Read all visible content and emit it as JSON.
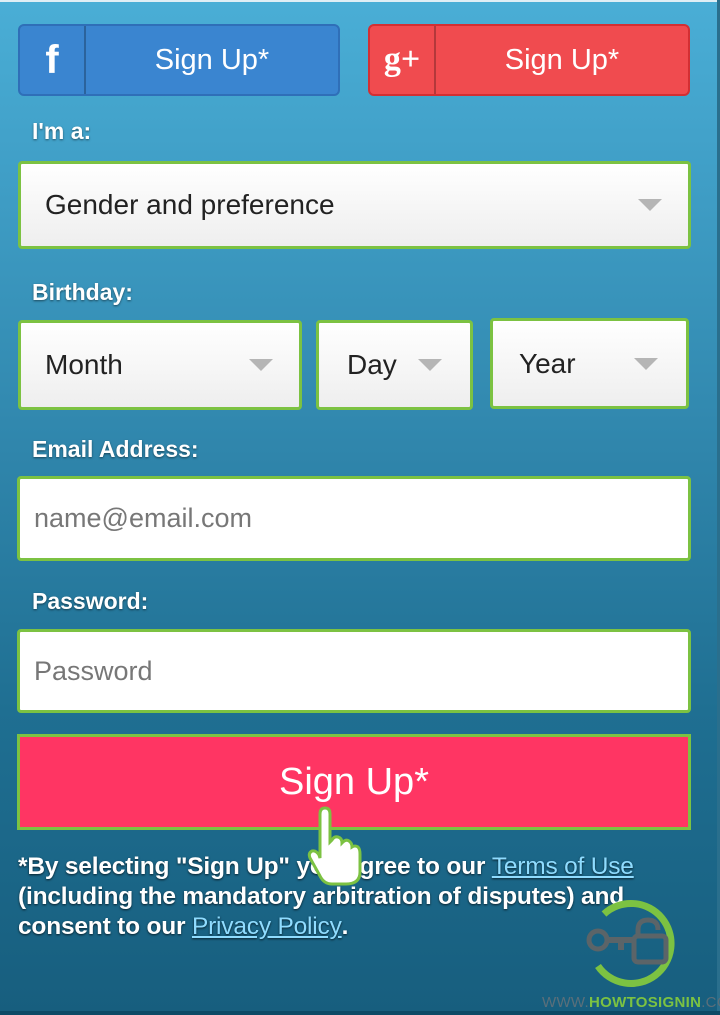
{
  "social": {
    "facebook": {
      "icon": "f",
      "label": "Sign Up*",
      "color": "#3a85d0"
    },
    "google": {
      "icon": "g+",
      "label": "Sign Up*",
      "color": "#f04b4f"
    }
  },
  "form": {
    "gender": {
      "label": "I'm a:",
      "selected": "Gender and preference"
    },
    "birthday": {
      "label": "Birthday:",
      "month": "Month",
      "day": "Day",
      "year": "Year"
    },
    "email": {
      "label": "Email Address:",
      "placeholder": "name@email.com",
      "value": ""
    },
    "password": {
      "label": "Password:",
      "placeholder": "Password",
      "value": ""
    },
    "submit_label": "Sign Up*",
    "submit_color": "#ff3563"
  },
  "legal": {
    "prefix": "*By selecting \"Sign Up\" you agree to our ",
    "terms_link": "Terms of Use",
    "middle": " (including the mandatory arbitration of disputes) and consent to our ",
    "privacy_link": "Privacy Policy",
    "suffix": "."
  },
  "watermark": {
    "www": "WWW.",
    "brand": "HOWTOSIGNIN",
    "tld": ".COM"
  }
}
